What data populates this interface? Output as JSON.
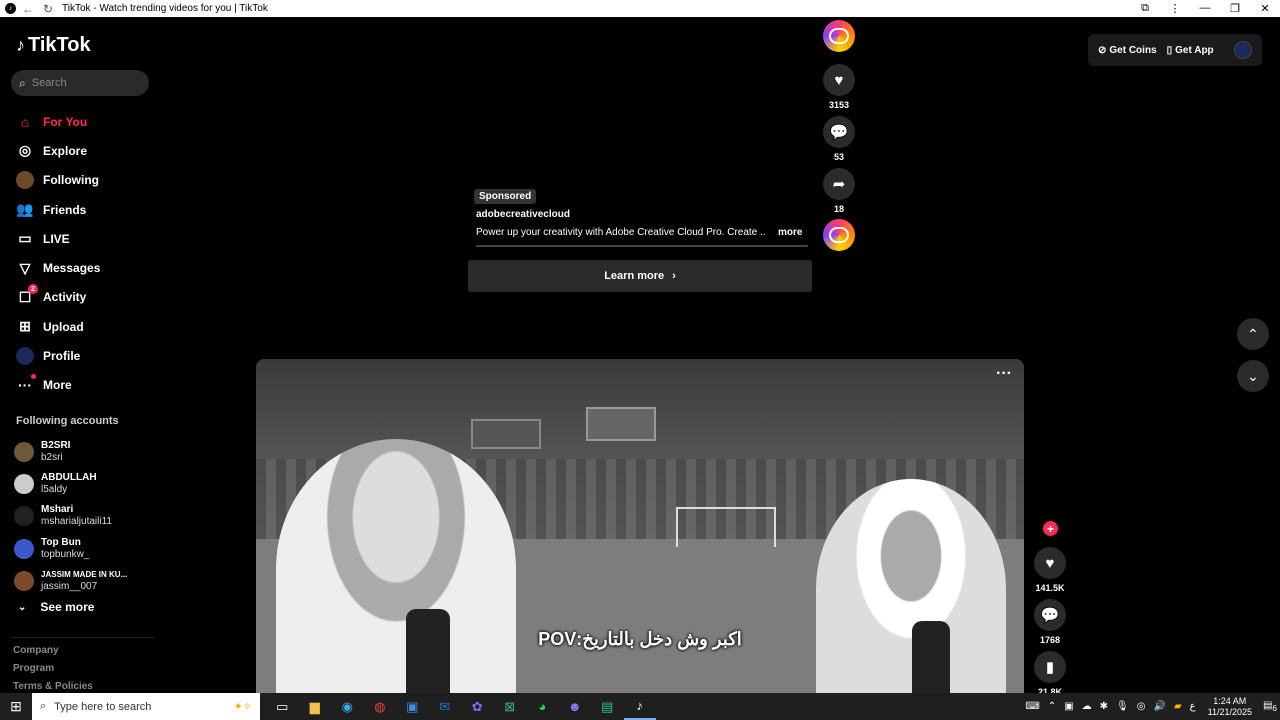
{
  "browser": {
    "title": "TikTok - Watch trending videos for you | TikTok"
  },
  "sidebar": {
    "logo": "TikTok",
    "search_placeholder": "Search",
    "nav": [
      {
        "label": "For You",
        "icon": "home-icon",
        "active": true
      },
      {
        "label": "Explore",
        "icon": "compass-icon"
      },
      {
        "label": "Following",
        "icon": "following-avatar-icon"
      },
      {
        "label": "Friends",
        "icon": "friends-icon"
      },
      {
        "label": "LIVE",
        "icon": "live-icon"
      },
      {
        "label": "Messages",
        "icon": "send-icon"
      },
      {
        "label": "Activity",
        "icon": "activity-icon",
        "badge": "2"
      },
      {
        "label": "Upload",
        "icon": "upload-icon"
      },
      {
        "label": "Profile",
        "icon": "profile-avatar-icon"
      },
      {
        "label": "More",
        "icon": "more-dots-icon"
      }
    ],
    "following_title": "Following accounts",
    "accounts": [
      {
        "name": "B2SRI",
        "username": "b2sri"
      },
      {
        "name": "ABDULLAH",
        "username": "l5aldy"
      },
      {
        "name": "Mshari",
        "username": "msharialjutaili11"
      },
      {
        "name": "Top Bun",
        "username": "topbunkw_"
      },
      {
        "name": "JASSIM MADE IN KU...",
        "username": "jassim__007"
      }
    ],
    "see_more": "See more",
    "footer": [
      "Company",
      "Program",
      "Terms & Policies"
    ]
  },
  "header": {
    "get_coins": "Get Coins",
    "get_app": "Get App"
  },
  "ad": {
    "sponsored": "Sponsored",
    "username": "adobecreativecloud",
    "description": "Power up your creativity with Adobe Creative Cloud Pro. Create ...",
    "more": "more",
    "learn_more": "Learn more",
    "likes": "3153",
    "comments": "53",
    "shares": "18"
  },
  "video": {
    "caption": "اكبر وش دخل بالتاريخ:POV",
    "likes": "141.5K",
    "comments": "1768",
    "saves": "21.8K"
  },
  "taskbar": {
    "search_placeholder": "Type here to search",
    "time": "1:24 AM",
    "date": "11/21/2025",
    "notifications": "6",
    "lang": "ع"
  }
}
